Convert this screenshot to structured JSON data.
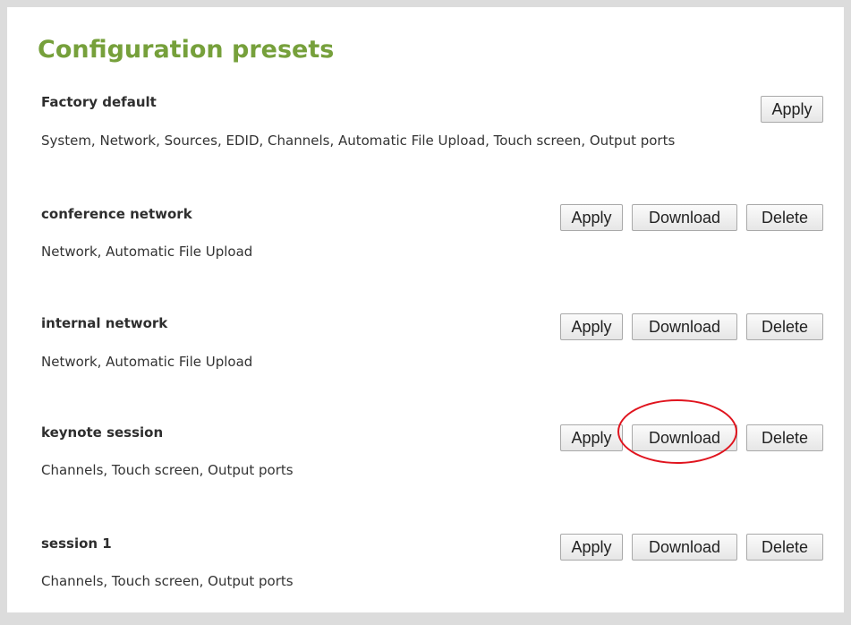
{
  "title": "Configuration presets",
  "presets": [
    {
      "name": "Factory default",
      "items": "System, Network, Sources, EDID, Channels, Automatic File Upload, Touch screen, Output ports",
      "apply_label": "Apply"
    },
    {
      "name": "conference network",
      "items": "Network, Automatic File Upload",
      "apply_label": "Apply",
      "download_label": "Download",
      "delete_label": "Delete"
    },
    {
      "name": "internal network",
      "items": "Network, Automatic File Upload",
      "apply_label": "Apply",
      "download_label": "Download",
      "delete_label": "Delete"
    },
    {
      "name": "keynote session",
      "items": "Channels, Touch screen, Output ports",
      "apply_label": "Apply",
      "download_label": "Download",
      "delete_label": "Delete"
    },
    {
      "name": "session 1",
      "items": "Channels, Touch screen, Output ports",
      "apply_label": "Apply",
      "download_label": "Download",
      "delete_label": "Delete"
    }
  ],
  "colors": {
    "title": "#76a03b",
    "highlight": "#e0141e"
  }
}
